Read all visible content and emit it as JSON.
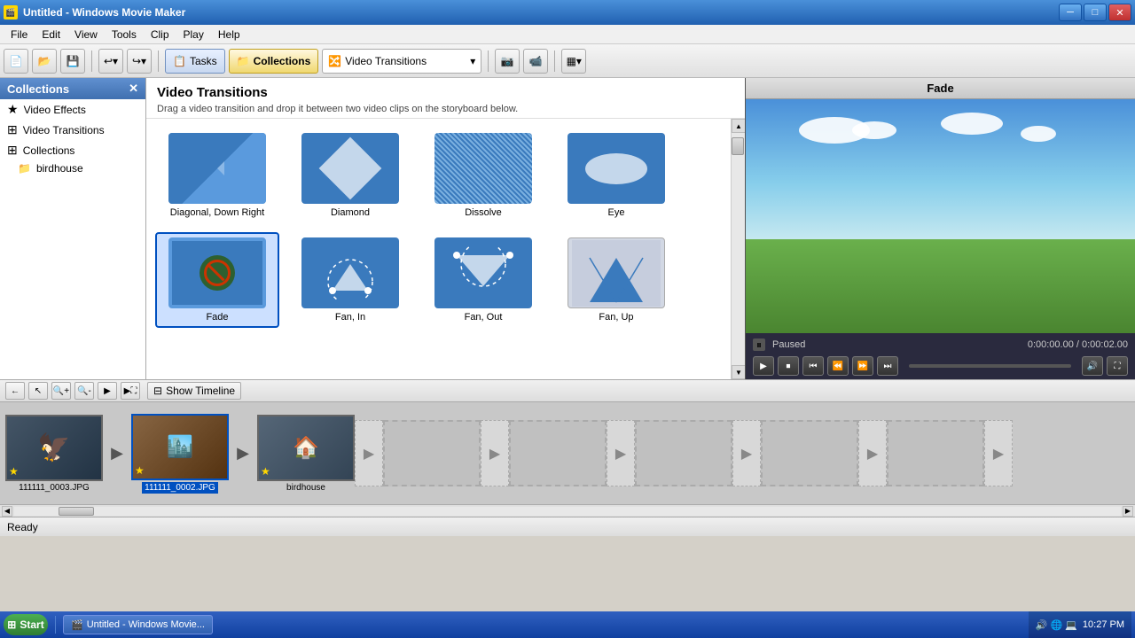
{
  "window": {
    "title": "Untitled - Windows Movie Maker",
    "icon": "🎬"
  },
  "titlebar": {
    "minimize_label": "─",
    "maximize_label": "□",
    "close_label": "✕"
  },
  "menu": {
    "items": [
      "File",
      "Edit",
      "View",
      "Tools",
      "Clip",
      "Play",
      "Help"
    ]
  },
  "toolbar": {
    "new_label": "📄",
    "open_label": "📂",
    "save_label": "💾",
    "undo_label": "↩",
    "redo_label": "↪",
    "tasks_label": "Tasks",
    "collections_label": "Collections",
    "transition_dropdown": "Video Transitions",
    "capture_label": "📷",
    "camera_label": "📹",
    "view_label": "▦"
  },
  "sidebar": {
    "title": "Collections",
    "close_label": "✕",
    "items": [
      {
        "label": "Video Effects",
        "icon": "★"
      },
      {
        "label": "Video Transitions",
        "icon": "⊞"
      },
      {
        "label": "Collections",
        "icon": "⊞"
      },
      {
        "label": "birdhouse",
        "icon": "📁"
      }
    ]
  },
  "content": {
    "title": "Video Transitions",
    "description": "Drag a video transition and drop it between two video clips on the storyboard below.",
    "transitions": [
      {
        "name": "Diagonal, Down Right",
        "type": "diagonal"
      },
      {
        "name": "Diamond",
        "type": "diamond"
      },
      {
        "name": "Dissolve",
        "type": "dissolve"
      },
      {
        "name": "Eye",
        "type": "eye"
      },
      {
        "name": "Fade",
        "type": "fade",
        "selected": true
      },
      {
        "name": "Fan, In",
        "type": "fan_in"
      },
      {
        "name": "Fan, Out",
        "type": "fan_out"
      },
      {
        "name": "Fan, Up",
        "type": "fan_up"
      }
    ]
  },
  "preview": {
    "title": "Fade",
    "status": "Paused",
    "time_current": "0:00:00.00",
    "time_total": "0:00:02.00",
    "time_display": "0:00:00.00 / 0:00:02.00"
  },
  "storyboard": {
    "show_timeline_label": "Show Timeline",
    "clips": [
      {
        "label": "111111_0003.JPG",
        "selected": false,
        "has_star": true
      },
      {
        "label": "111111_0002.JPG",
        "selected": true,
        "has_star": true
      },
      {
        "label": "birdhouse",
        "selected": false,
        "has_star": true
      }
    ]
  },
  "statusbar": {
    "text": "Ready"
  },
  "taskbar": {
    "start_label": "Start",
    "app_label": "Untitled - Windows Movie...",
    "time": "10:27 PM",
    "system_icons": [
      "🔊",
      "🌐",
      "💻"
    ]
  }
}
